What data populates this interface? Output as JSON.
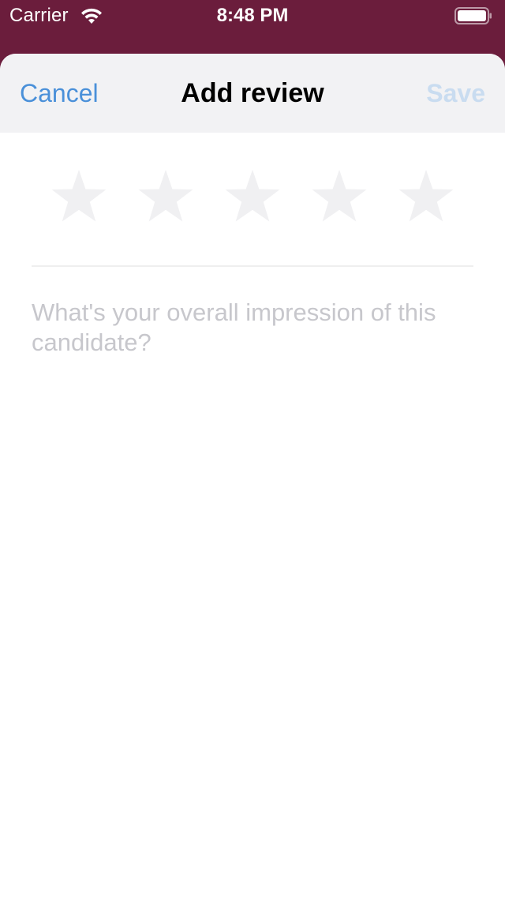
{
  "status_bar": {
    "carrier": "Carrier",
    "time": "8:48 PM"
  },
  "nav": {
    "cancel_label": "Cancel",
    "title": "Add review",
    "save_label": "Save"
  },
  "rating": {
    "max": 5,
    "value": 0
  },
  "review": {
    "placeholder": "What's your overall impression of this candidate?",
    "value": ""
  },
  "colors": {
    "status_bar_bg": "#6b1d3c",
    "nav_bg": "#f2f2f4",
    "accent": "#4a90d9",
    "save_disabled": "#c9dcf0",
    "star_empty": "#f0f0f2",
    "placeholder": "#c7c7cc"
  },
  "icons": {
    "wifi": "wifi-icon",
    "battery": "battery-icon",
    "star": "star-icon"
  }
}
